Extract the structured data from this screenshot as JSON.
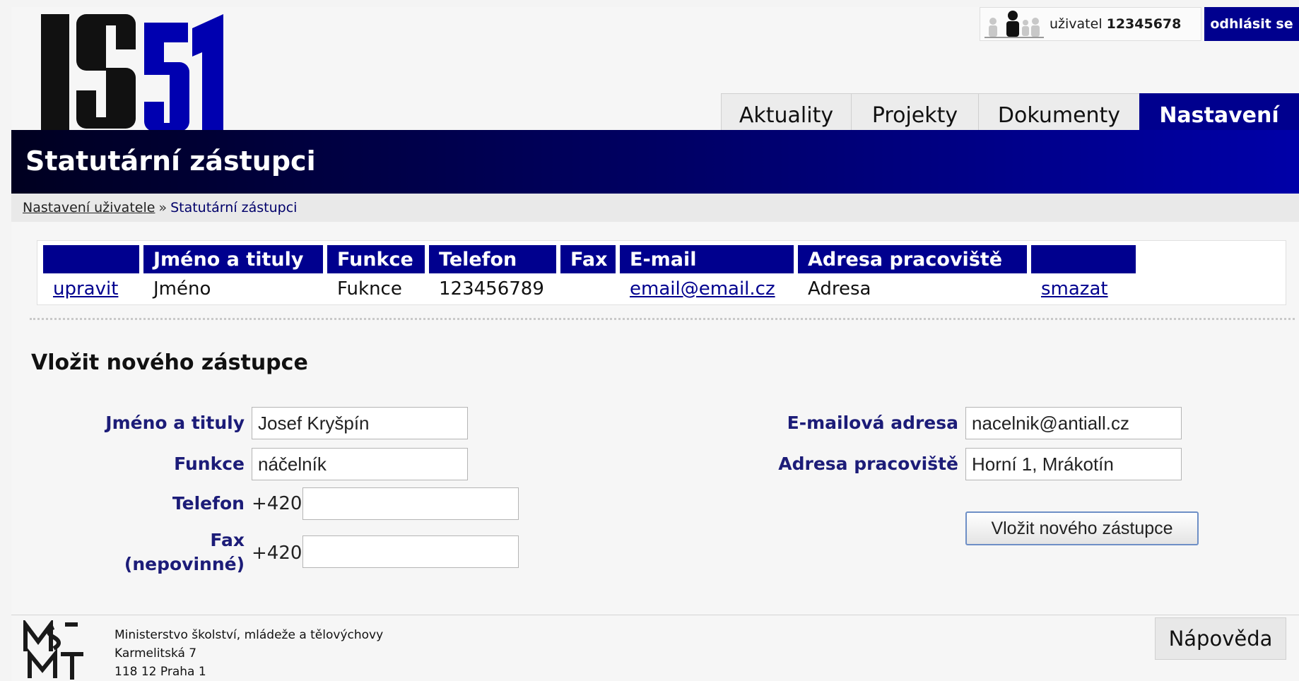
{
  "brand": {
    "logo_text": "IS51"
  },
  "user": {
    "label": "uživatel",
    "number": "12345678",
    "logout": "odhlásit se"
  },
  "tabs": [
    {
      "label": "Aktuality",
      "active": false
    },
    {
      "label": "Projekty",
      "active": false
    },
    {
      "label": "Dokumenty",
      "active": false
    },
    {
      "label": "Nastavení",
      "active": true
    }
  ],
  "page_title": "Statutární zástupci",
  "breadcrumb": {
    "link": "Nastavení uživatele",
    "separator": "»",
    "current": "Statutární zástupci"
  },
  "table": {
    "headers": [
      "",
      "Jméno a tituly",
      "Funkce",
      "Telefon",
      "Fax",
      "E-mail",
      "Adresa pracoviště",
      ""
    ],
    "rows": [
      {
        "edit": "upravit",
        "name": "Jméno",
        "function": "Fuknce",
        "phone": "123456789",
        "fax": "",
        "email": "email@email.cz",
        "address": "Adresa",
        "delete": "smazat"
      }
    ]
  },
  "form": {
    "title": "Vložit nového zástupce",
    "name_label": "Jméno a tituly",
    "name_value": "Josef Kryšpín",
    "function_label": "Funkce",
    "function_value": "náčelník",
    "phone_label": "Telefon",
    "phone_prefix": "+420",
    "phone_value": "",
    "fax_label": "Fax",
    "fax_note": "(nepovinné)",
    "fax_prefix": "+420",
    "fax_value": "",
    "email_label": "E-mailová adresa",
    "email_value": "nacelnik@antiall.cz",
    "address_label": "Adresa pracoviště",
    "address_value": "Horní 1, Mrákotín",
    "submit": "Vložit nového zástupce"
  },
  "footer": {
    "org": "Ministerstvo školství, mládeže a tělovýchovy",
    "street": "Karmelitská 7",
    "city": "118 12 Praha 1",
    "help": "Nápověda"
  },
  "colors": {
    "brand_blue": "#00008e",
    "title_bar_dark": "#000020",
    "label_blue": "#1c1c78"
  }
}
